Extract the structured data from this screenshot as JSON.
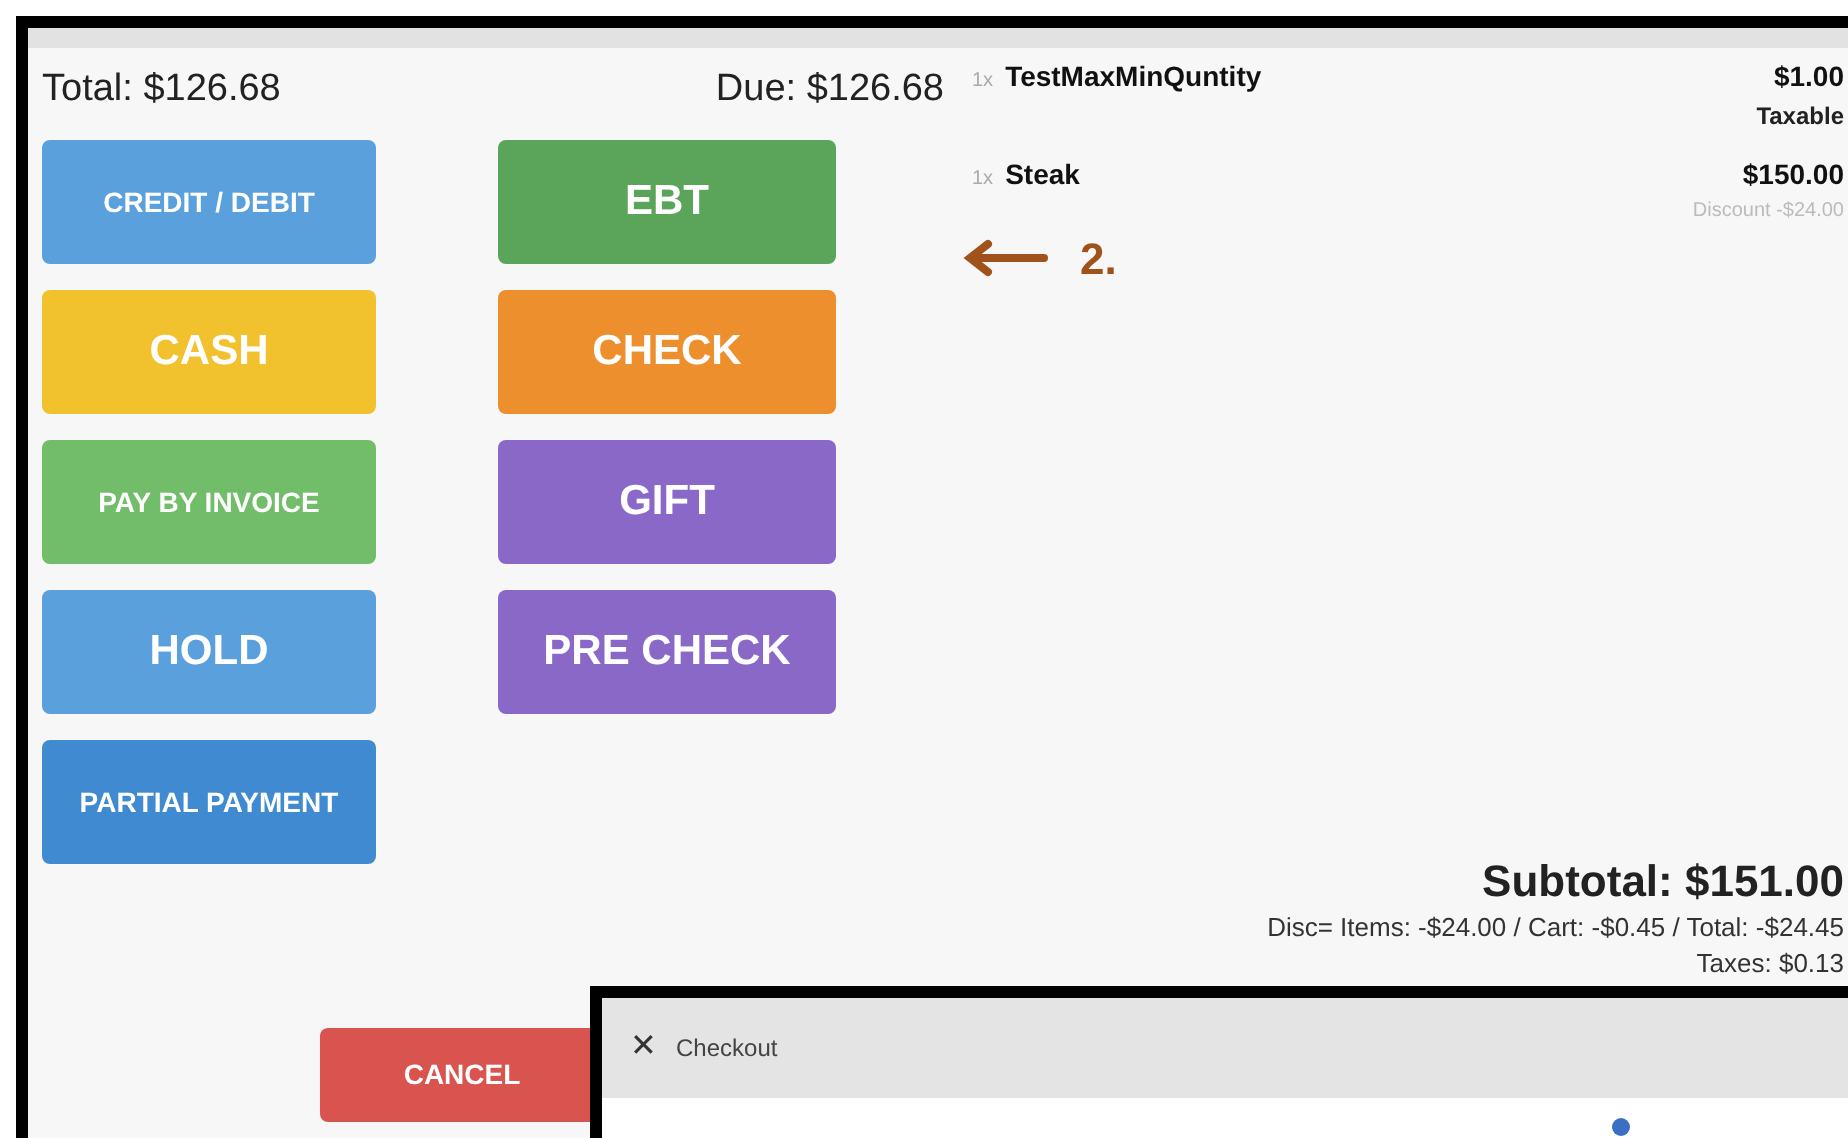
{
  "payment": {
    "total": "Total: $126.68",
    "due": "Due: $126.68",
    "buttons": [
      {
        "label": "CREDIT / DEBIT",
        "color": "#5aa0dd",
        "kind": "compact"
      },
      {
        "label": "EBT",
        "color": "#5ba55b",
        "kind": "big"
      },
      {
        "label": "CASH",
        "color": "#f2c12e",
        "kind": "big"
      },
      {
        "label": "CHECK",
        "color": "#ee8f2e",
        "kind": "big"
      },
      {
        "label": "PAY BY INVOICE",
        "color": "#72bd6a",
        "kind": "compact"
      },
      {
        "label": "GIFT",
        "color": "#8a68c8",
        "kind": "big"
      },
      {
        "label": "HOLD",
        "color": "#5aa0dd",
        "kind": "big"
      },
      {
        "label": "PRE CHECK",
        "color": "#8a68c8",
        "kind": "big"
      },
      {
        "label": "PARTIAL PAYMENT",
        "color": "#3f8ad0",
        "kind": "compact"
      }
    ],
    "cancel": "CANCEL"
  },
  "cart": {
    "items": [
      {
        "qty": "1x",
        "name": "TestMaxMinQuntity",
        "price": "$1.00",
        "note": "Taxable",
        "kind": "taxable"
      },
      {
        "qty": "1x",
        "name": "Steak",
        "price": "$150.00",
        "note": "Discount -$24.00",
        "kind": "discounted"
      }
    ],
    "subtotal": "Subtotal: $151.00",
    "discounts": "Disc= Items: -$24.00 / Cart: -$0.45 / Total: -$24.45",
    "taxes": "Taxes: $0.13"
  },
  "annotation": {
    "label": "2."
  },
  "checkout_window": {
    "close": "✕",
    "title": "Checkout"
  }
}
